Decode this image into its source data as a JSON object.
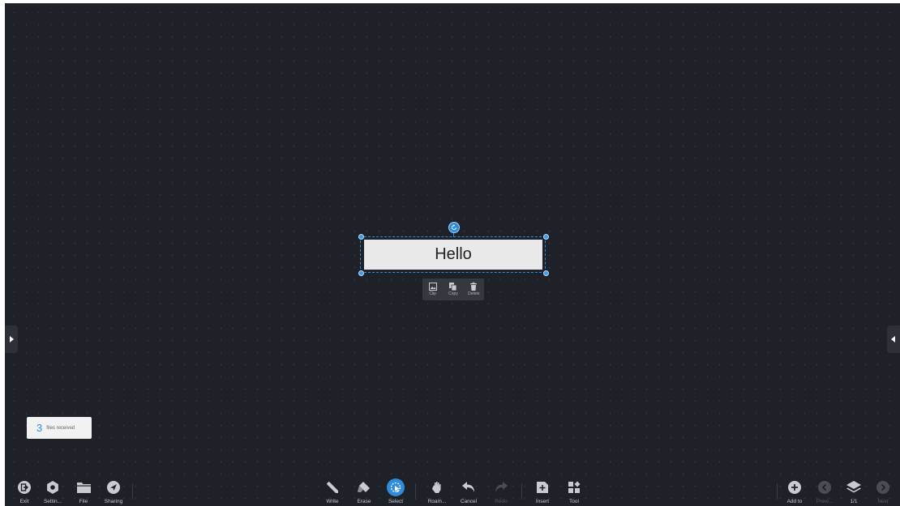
{
  "selection": {
    "text": "Hello",
    "menu": [
      {
        "id": "clip",
        "label": "Clip",
        "icon": "image-clip-icon"
      },
      {
        "id": "copy",
        "label": "Copy",
        "icon": "copy-icon"
      },
      {
        "id": "delete",
        "label": "Delete",
        "icon": "trash-icon"
      }
    ]
  },
  "toast": {
    "count": "3",
    "text": "files received"
  },
  "toolbar": {
    "left": [
      {
        "id": "exit",
        "label": "Exit",
        "icon": "exit-icon"
      },
      {
        "id": "settings",
        "label": "Settin...",
        "icon": "gear-icon"
      },
      {
        "id": "file",
        "label": "File",
        "icon": "folder-icon"
      },
      {
        "id": "sharing",
        "label": "Sharing",
        "icon": "send-icon"
      }
    ],
    "center": [
      {
        "id": "write",
        "label": "Write",
        "icon": "pen-icon"
      },
      {
        "id": "erase",
        "label": "Erase",
        "icon": "eraser-icon"
      },
      {
        "id": "select",
        "label": "Select",
        "icon": "select-cursor-icon",
        "active": true
      },
      {
        "id": "roam",
        "label": "Roam...",
        "icon": "hand-icon"
      },
      {
        "id": "cancel",
        "label": "Cancel",
        "icon": "undo-icon"
      },
      {
        "id": "redo",
        "label": "Redo",
        "icon": "redo-icon",
        "disabled": true
      },
      {
        "id": "insert",
        "label": "Insert",
        "icon": "insert-icon"
      },
      {
        "id": "tool",
        "label": "Tool",
        "icon": "tools-grid-icon"
      }
    ],
    "right": [
      {
        "id": "add",
        "label": "Add to",
        "icon": "plus-circle-icon"
      },
      {
        "id": "prev",
        "label": "Previ...",
        "icon": "chevron-left-circle-icon",
        "disabled": true
      },
      {
        "id": "pages",
        "label": "1/1",
        "icon": "layers-icon"
      },
      {
        "id": "next",
        "label": "Next",
        "icon": "chevron-right-circle-icon",
        "disabled": true
      }
    ]
  },
  "colors": {
    "canvas": "#1f2128",
    "accent": "#2f8cdb",
    "toolbar_text": "#c9cbd0"
  }
}
